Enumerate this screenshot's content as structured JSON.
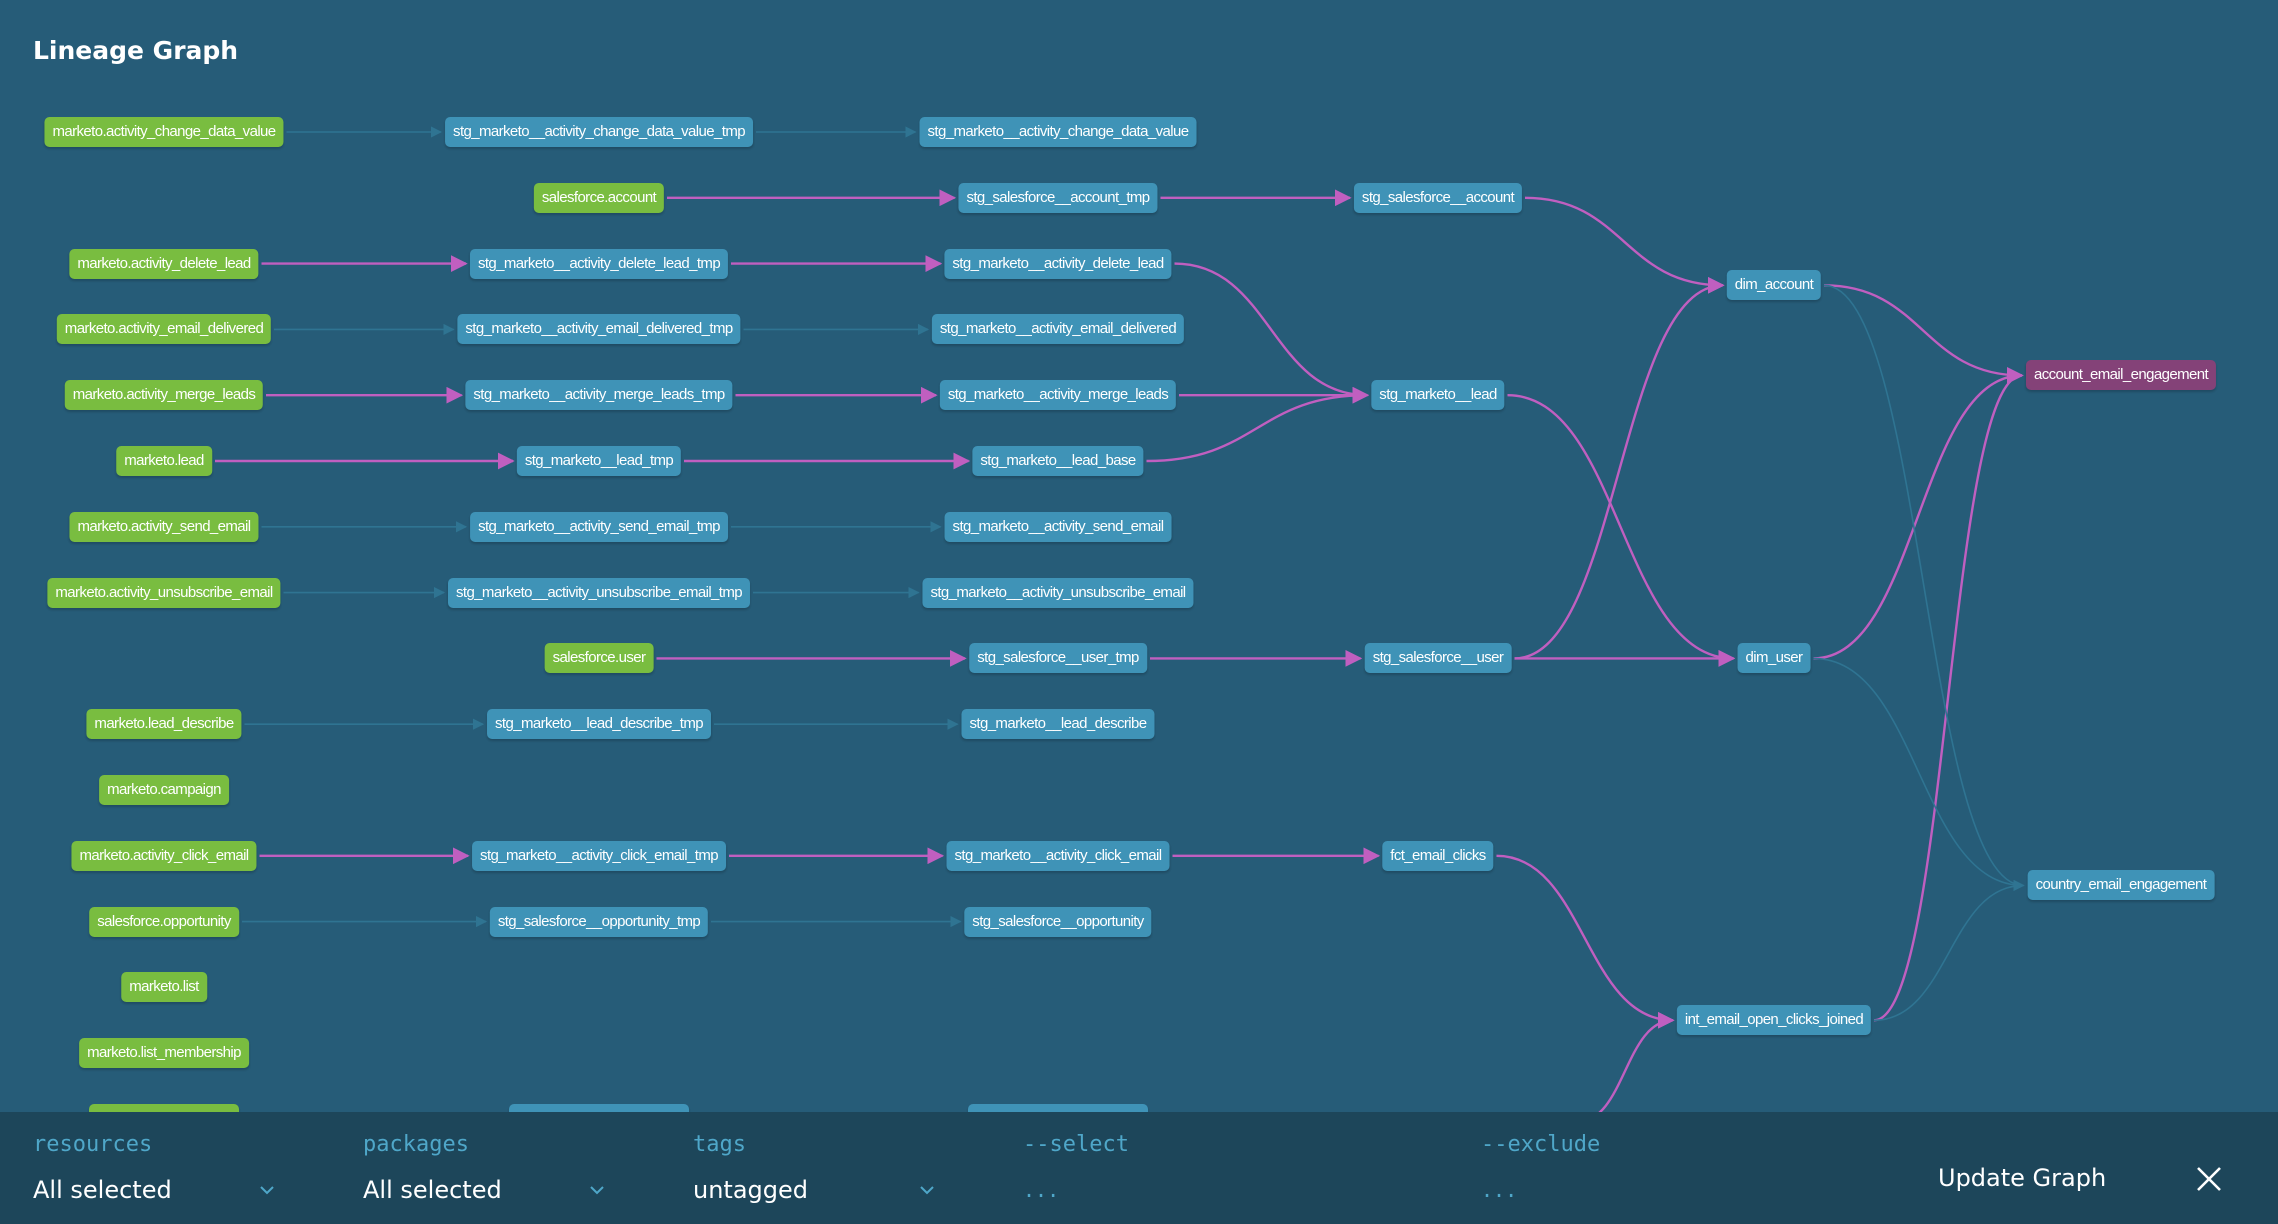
{
  "title": "Lineage Graph",
  "colors": {
    "background": "#265c78",
    "source_node": "#79bd40",
    "model_node": "#3f93b7",
    "selected_node": "#844278",
    "highlight_edge": "#c05fc0",
    "dim_edge": "#2f7492",
    "bottom_bar": "#1d465a",
    "filter_label": "#4fa7c9"
  },
  "nodes": [
    {
      "id": "src_acdv",
      "label": "marketo.activity_change_data_value",
      "type": "source",
      "col": 0,
      "row": 0
    },
    {
      "id": "src_sf_account",
      "label": "salesforce.account",
      "type": "source",
      "col": 1,
      "row": 1
    },
    {
      "id": "src_adl",
      "label": "marketo.activity_delete_lead",
      "type": "source",
      "col": 0,
      "row": 2
    },
    {
      "id": "src_aed",
      "label": "marketo.activity_email_delivered",
      "type": "source",
      "col": 0,
      "row": 3
    },
    {
      "id": "src_aml",
      "label": "marketo.activity_merge_leads",
      "type": "source",
      "col": 0,
      "row": 4
    },
    {
      "id": "src_lead",
      "label": "marketo.lead",
      "type": "source",
      "col": 0,
      "row": 5
    },
    {
      "id": "src_ase",
      "label": "marketo.activity_send_email",
      "type": "source",
      "col": 0,
      "row": 6
    },
    {
      "id": "src_aue",
      "label": "marketo.activity_unsubscribe_email",
      "type": "source",
      "col": 0,
      "row": 7
    },
    {
      "id": "src_sf_user",
      "label": "salesforce.user",
      "type": "source",
      "col": 1,
      "row": 8
    },
    {
      "id": "src_ld",
      "label": "marketo.lead_describe",
      "type": "source",
      "col": 0,
      "row": 9
    },
    {
      "id": "src_campaign",
      "label": "marketo.campaign",
      "type": "source",
      "col": 0,
      "row": 10
    },
    {
      "id": "src_ace",
      "label": "marketo.activity_click_email",
      "type": "source",
      "col": 0,
      "row": 11
    },
    {
      "id": "src_sf_opp",
      "label": "salesforce.opportunity",
      "type": "source",
      "col": 0,
      "row": 12
    },
    {
      "id": "src_list",
      "label": "marketo.list",
      "type": "source",
      "col": 0,
      "row": 13
    },
    {
      "id": "src_list_mem",
      "label": "marketo.list_membership",
      "type": "source",
      "col": 0,
      "row": 14
    },
    {
      "id": "src_partial",
      "label": "",
      "type": "source",
      "col": 0,
      "row": 15,
      "partial": true
    },
    {
      "id": "tmp_acdv",
      "label": "stg_marketo__activity_change_data_value_tmp",
      "type": "model",
      "col": 1,
      "row": 0
    },
    {
      "id": "tmp_adl",
      "label": "stg_marketo__activity_delete_lead_tmp",
      "type": "model",
      "col": 1,
      "row": 2
    },
    {
      "id": "tmp_aed",
      "label": "stg_marketo__activity_email_delivered_tmp",
      "type": "model",
      "col": 1,
      "row": 3
    },
    {
      "id": "tmp_aml",
      "label": "stg_marketo__activity_merge_leads_tmp",
      "type": "model",
      "col": 1,
      "row": 4
    },
    {
      "id": "tmp_lead",
      "label": "stg_marketo__lead_tmp",
      "type": "model",
      "col": 1,
      "row": 5
    },
    {
      "id": "tmp_ase",
      "label": "stg_marketo__activity_send_email_tmp",
      "type": "model",
      "col": 1,
      "row": 6
    },
    {
      "id": "tmp_aue",
      "label": "stg_marketo__activity_unsubscribe_email_tmp",
      "type": "model",
      "col": 1,
      "row": 7
    },
    {
      "id": "tmp_ld",
      "label": "stg_marketo__lead_describe_tmp",
      "type": "model",
      "col": 1,
      "row": 9
    },
    {
      "id": "tmp_ace",
      "label": "stg_marketo__activity_click_email_tmp",
      "type": "model",
      "col": 1,
      "row": 11
    },
    {
      "id": "tmp_sf_opp",
      "label": "stg_salesforce__opportunity_tmp",
      "type": "model",
      "col": 1,
      "row": 12
    },
    {
      "id": "tmp_partial",
      "label": "",
      "type": "model",
      "col": 1,
      "row": 15,
      "partial": true
    },
    {
      "id": "stg_acdv",
      "label": "stg_marketo__activity_change_data_value",
      "type": "model",
      "col": 2,
      "row": 0
    },
    {
      "id": "tmp_sf_account",
      "label": "stg_salesforce__account_tmp",
      "type": "model",
      "col": 2,
      "row": 1
    },
    {
      "id": "stg_adl",
      "label": "stg_marketo__activity_delete_lead",
      "type": "model",
      "col": 2,
      "row": 2
    },
    {
      "id": "stg_aed",
      "label": "stg_marketo__activity_email_delivered",
      "type": "model",
      "col": 2,
      "row": 3
    },
    {
      "id": "stg_aml",
      "label": "stg_marketo__activity_merge_leads",
      "type": "model",
      "col": 2,
      "row": 4
    },
    {
      "id": "stg_lead_base",
      "label": "stg_marketo__lead_base",
      "type": "model",
      "col": 2,
      "row": 5
    },
    {
      "id": "stg_ase",
      "label": "stg_marketo__activity_send_email",
      "type": "model",
      "col": 2,
      "row": 6
    },
    {
      "id": "stg_aue",
      "label": "stg_marketo__activity_unsubscribe_email",
      "type": "model",
      "col": 2,
      "row": 7
    },
    {
      "id": "tmp_sf_user",
      "label": "stg_salesforce__user_tmp",
      "type": "model",
      "col": 2,
      "row": 8
    },
    {
      "id": "stg_ld",
      "label": "stg_marketo__lead_describe",
      "type": "model",
      "col": 2,
      "row": 9
    },
    {
      "id": "stg_ace",
      "label": "stg_marketo__activity_click_email",
      "type": "model",
      "col": 2,
      "row": 11
    },
    {
      "id": "stg_sf_opp",
      "label": "stg_salesforce__opportunity",
      "type": "model",
      "col": 2,
      "row": 12
    },
    {
      "id": "stg_partial",
      "label": "",
      "type": "model",
      "col": 2,
      "row": 15,
      "partial": true
    },
    {
      "id": "stg_sf_account",
      "label": "stg_salesforce__account",
      "type": "model",
      "col": 3,
      "row": 1
    },
    {
      "id": "stg_lead",
      "label": "stg_marketo__lead",
      "type": "model",
      "col": 3,
      "row": 4
    },
    {
      "id": "stg_sf_user",
      "label": "stg_salesforce__user",
      "type": "model",
      "col": 3,
      "row": 8
    },
    {
      "id": "fct_clicks",
      "label": "fct_email_clicks",
      "type": "model",
      "col": 3,
      "row": 11
    },
    {
      "id": "dim_account",
      "label": "dim_account",
      "type": "model",
      "col": 4,
      "row": 2.33
    },
    {
      "id": "dim_user",
      "label": "dim_user",
      "type": "model",
      "col": 4,
      "row": 8
    },
    {
      "id": "int_joined",
      "label": "int_email_open_clicks_joined",
      "type": "model",
      "col": 4,
      "row": 13.5
    },
    {
      "id": "acct_eng",
      "label": "account_email_engagement",
      "type": "selected",
      "col": 5,
      "row": 3.7
    },
    {
      "id": "country_eng",
      "label": "country_email_engagement",
      "type": "model",
      "col": 5,
      "row": 11.45
    }
  ],
  "edges": [
    {
      "from": "src_acdv",
      "to": "tmp_acdv",
      "highlight": false
    },
    {
      "from": "tmp_acdv",
      "to": "stg_acdv",
      "highlight": false
    },
    {
      "from": "src_sf_account",
      "to": "tmp_sf_account",
      "highlight": true
    },
    {
      "from": "tmp_sf_account",
      "to": "stg_sf_account",
      "highlight": true
    },
    {
      "from": "src_adl",
      "to": "tmp_adl",
      "highlight": true
    },
    {
      "from": "tmp_adl",
      "to": "stg_adl",
      "highlight": true
    },
    {
      "from": "src_aed",
      "to": "tmp_aed",
      "highlight": false
    },
    {
      "from": "tmp_aed",
      "to": "stg_aed",
      "highlight": false
    },
    {
      "from": "src_aml",
      "to": "tmp_aml",
      "highlight": true
    },
    {
      "from": "tmp_aml",
      "to": "stg_aml",
      "highlight": true
    },
    {
      "from": "src_lead",
      "to": "tmp_lead",
      "highlight": true
    },
    {
      "from": "tmp_lead",
      "to": "stg_lead_base",
      "highlight": true
    },
    {
      "from": "src_ase",
      "to": "tmp_ase",
      "highlight": false
    },
    {
      "from": "tmp_ase",
      "to": "stg_ase",
      "highlight": false
    },
    {
      "from": "src_aue",
      "to": "tmp_aue",
      "highlight": false
    },
    {
      "from": "tmp_aue",
      "to": "stg_aue",
      "highlight": false
    },
    {
      "from": "src_sf_user",
      "to": "tmp_sf_user",
      "highlight": true
    },
    {
      "from": "tmp_sf_user",
      "to": "stg_sf_user",
      "highlight": true
    },
    {
      "from": "src_ld",
      "to": "tmp_ld",
      "highlight": false
    },
    {
      "from": "tmp_ld",
      "to": "stg_ld",
      "highlight": false
    },
    {
      "from": "src_ace",
      "to": "tmp_ace",
      "highlight": true
    },
    {
      "from": "tmp_ace",
      "to": "stg_ace",
      "highlight": true
    },
    {
      "from": "src_sf_opp",
      "to": "tmp_sf_opp",
      "highlight": false
    },
    {
      "from": "tmp_sf_opp",
      "to": "stg_sf_opp",
      "highlight": false
    },
    {
      "from": "stg_adl",
      "to": "stg_lead",
      "highlight": true
    },
    {
      "from": "stg_aml",
      "to": "stg_lead",
      "highlight": true
    },
    {
      "from": "stg_lead_base",
      "to": "stg_lead",
      "highlight": true
    },
    {
      "from": "stg_ace",
      "to": "fct_clicks",
      "highlight": true
    },
    {
      "from": "stg_sf_account",
      "to": "dim_account",
      "highlight": true
    },
    {
      "from": "stg_sf_user",
      "to": "dim_account",
      "highlight": true
    },
    {
      "from": "stg_lead",
      "to": "dim_user",
      "highlight": true
    },
    {
      "from": "stg_sf_user",
      "to": "dim_user",
      "highlight": true
    },
    {
      "from": "fct_clicks",
      "to": "int_joined",
      "highlight": true
    },
    {
      "from": "dim_account",
      "to": "acct_eng",
      "highlight": true
    },
    {
      "from": "dim_user",
      "to": "acct_eng",
      "highlight": true
    },
    {
      "from": "int_joined",
      "to": "acct_eng",
      "highlight": true
    },
    {
      "from": "dim_account",
      "to": "country_eng",
      "highlight": false
    },
    {
      "from": "dim_user",
      "to": "country_eng",
      "highlight": false
    },
    {
      "from": "int_joined",
      "to": "country_eng",
      "highlight": false
    }
  ],
  "partial_edges": [
    {
      "to": "int_joined",
      "highlight": true
    }
  ],
  "filters": [
    {
      "id": "resources",
      "label": "resources",
      "value": "All selected",
      "kind": "select"
    },
    {
      "id": "packages",
      "label": "packages",
      "value": "All selected",
      "kind": "select"
    },
    {
      "id": "tags",
      "label": "tags",
      "value": "untagged",
      "kind": "select"
    },
    {
      "id": "select",
      "label": "--select",
      "placeholder": "...",
      "kind": "text"
    },
    {
      "id": "exclude",
      "label": "--exclude",
      "placeholder": "...",
      "kind": "text"
    }
  ],
  "actions": {
    "update_label": "Update Graph",
    "close_icon": "close-icon"
  }
}
